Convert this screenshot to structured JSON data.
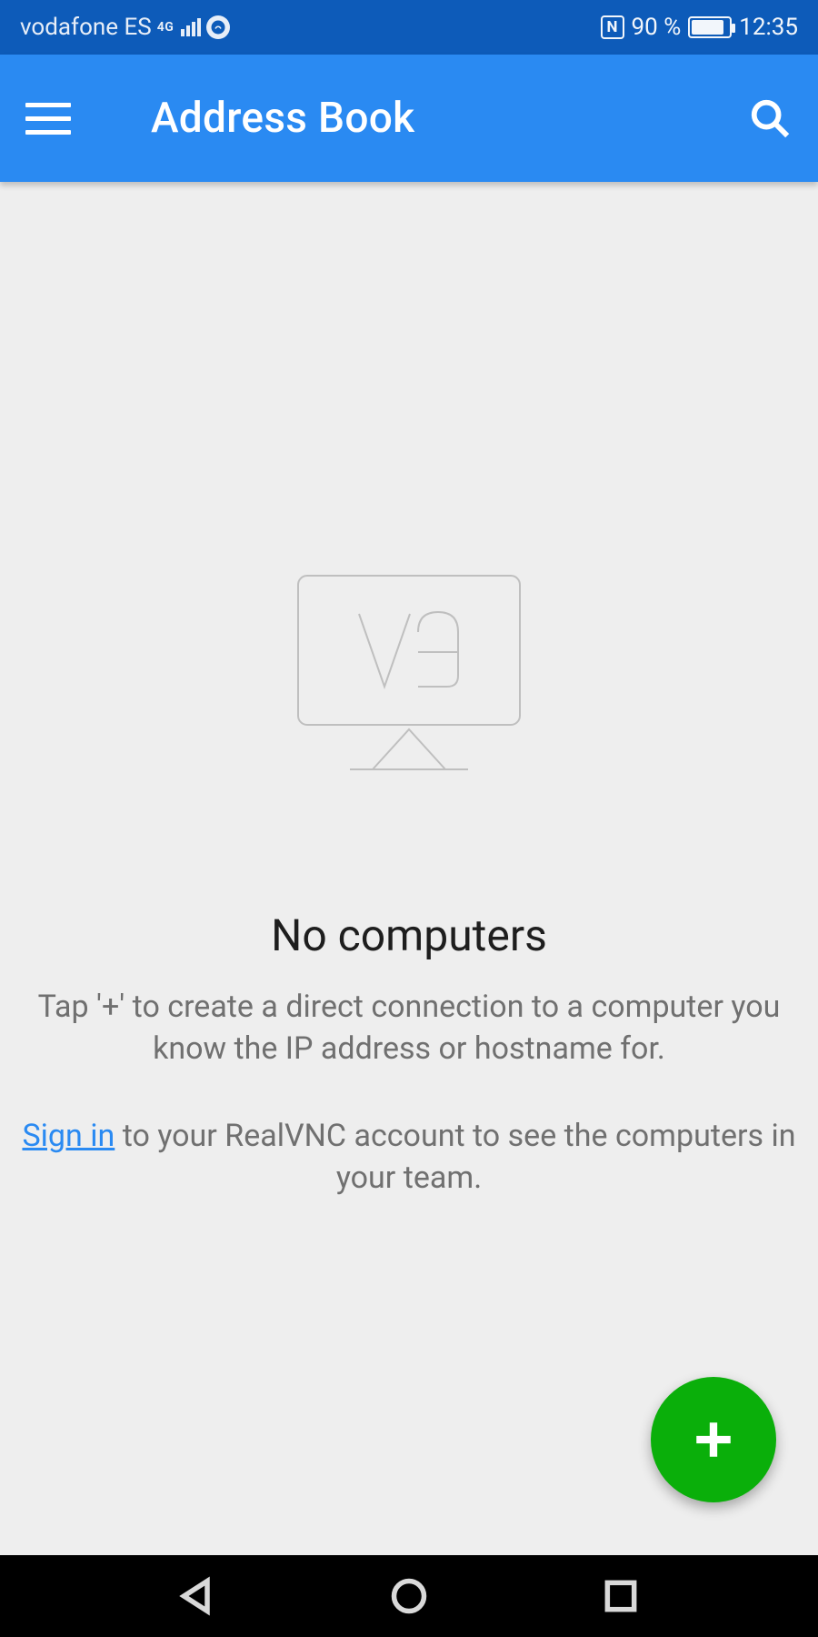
{
  "status_bar": {
    "carrier": "vodafone ES",
    "network_badge": "4G",
    "battery_percent": "90 %",
    "time": "12:35"
  },
  "app_bar": {
    "title": "Address Book"
  },
  "empty_state": {
    "heading": "No computers",
    "subtext": "Tap '+' to create a direct connection to a computer you know the IP address or hostname for.",
    "signin_link_text": "Sign in",
    "signin_rest": " to your RealVNC account to see the computers in your team."
  },
  "colors": {
    "status_bg": "#0d5bb9",
    "appbar_bg": "#2a8af2",
    "fab_bg": "#0aaf0a",
    "link": "#2a8af2"
  }
}
